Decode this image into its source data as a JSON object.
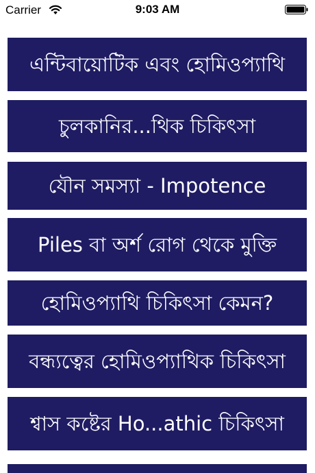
{
  "status_bar": {
    "carrier": "Carrier",
    "time": "9:03 AM",
    "wifi_icon": "wifi-icon",
    "battery_icon": "battery-icon"
  },
  "colors": {
    "row_background": "#1f1c63",
    "row_text": "#ffffff",
    "page_background": "#ffffff"
  },
  "list": {
    "items": [
      {
        "label": "এন্টিবায়োটিক এবং হোমিওপ্যাথি"
      },
      {
        "label": "চুলকানির...থিক চিকিৎসা"
      },
      {
        "label": "যৌন সমস্যা - Impotence"
      },
      {
        "label": "Piles বা অর্শ রোগ থেকে মুক্তি"
      },
      {
        "label": "হোমিওপ্যাথি চিকিৎসা কেমন?"
      },
      {
        "label": "বন্ধ্যত্বের হোমিওপ্যাথিক চিকিৎসা"
      },
      {
        "label": "শ্বাস কষ্টের Ho...athic চিকিৎসা"
      },
      {
        "label": ""
      }
    ]
  }
}
